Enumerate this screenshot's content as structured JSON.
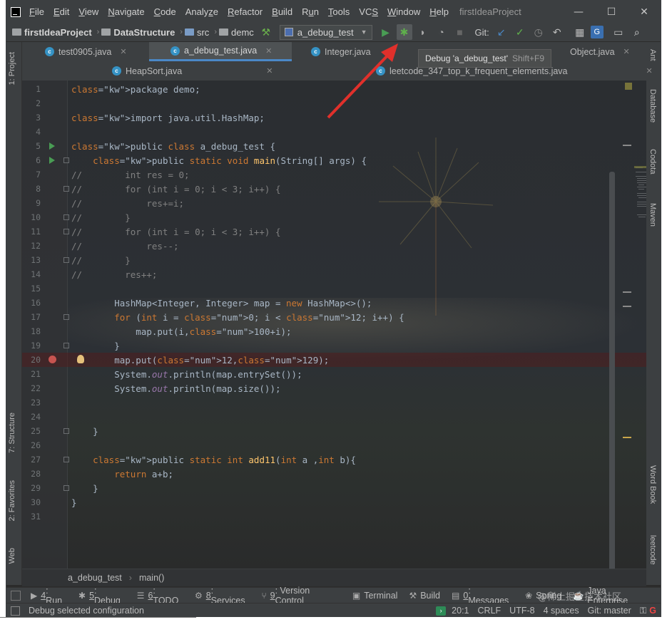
{
  "window": {
    "title": "firstIdeaProject",
    "controls": {
      "minimize": "—",
      "maximize": "☐",
      "close": "✕"
    }
  },
  "menu": [
    {
      "label": "File",
      "key": "F"
    },
    {
      "label": "Edit",
      "key": "E"
    },
    {
      "label": "View",
      "key": "V"
    },
    {
      "label": "Navigate",
      "key": "N"
    },
    {
      "label": "Code",
      "key": "C"
    },
    {
      "label": "Analyze",
      "key": "z"
    },
    {
      "label": "Refactor",
      "key": "R"
    },
    {
      "label": "Build",
      "key": "B"
    },
    {
      "label": "Run",
      "key": "u"
    },
    {
      "label": "Tools",
      "key": "T"
    },
    {
      "label": "VCS",
      "key": "S"
    },
    {
      "label": "Window",
      "key": "W"
    },
    {
      "label": "Help",
      "key": "H"
    }
  ],
  "navbar": {
    "project": "firstIdeaProject",
    "module": "DataStructure",
    "src": "src",
    "package": "demc",
    "run_config": "a_debug_test",
    "git_label": "Git:"
  },
  "tooltip": {
    "text": "Debug 'a_debug_test'",
    "shortcut": "Shift+F9"
  },
  "tabs": {
    "row1": [
      {
        "label": "test0905.java",
        "active": false
      },
      {
        "label": "a_debug_test.java",
        "active": true
      },
      {
        "label": "Integer.java",
        "active": false
      },
      {
        "label": "Object.java",
        "active": false
      }
    ],
    "row2": [
      {
        "label": "HeapSort.java"
      },
      {
        "label": "leetcode_347_top_k_frequent_elements.java"
      }
    ]
  },
  "left_tools": {
    "project": "1: Project",
    "structure": "7: Structure",
    "favorites": "2: Favorites",
    "web": "Web"
  },
  "right_tools": {
    "ant": "Ant",
    "database": "Database",
    "codota": "Codota",
    "maven": "Maven",
    "wordbook": "Word Book",
    "leetcode": "leetcode"
  },
  "code": {
    "lines": [
      "package demo;",
      "",
      "import java.util.HashMap;",
      "",
      "public class a_debug_test {",
      "    public static void main(String[] args) {",
      "//        int res = 0;",
      "//        for (int i = 0; i < 3; i++) {",
      "//            res+=i;",
      "//        }",
      "//        for (int i = 0; i < 3; i++) {",
      "//            res--;",
      "//        }",
      "//        res++;",
      "",
      "        HashMap<Integer, Integer> map = new HashMap<>();",
      "        for (int i = 0; i < 12; i++) {",
      "            map.put(i,100+i);",
      "        }",
      "        map.put(12,129);",
      "        System.out.println(map.entrySet());",
      "        System.out.println(map.size());",
      "",
      "",
      "    }",
      "",
      "    public static int add11(int a ,int b){",
      "        return a+b;",
      "    }",
      "}",
      ""
    ],
    "breakpoint_line": 20
  },
  "crumbbar": {
    "class": "a_debug_test",
    "method": "main()"
  },
  "toolwindows": [
    {
      "num": "4",
      "label": ": Run",
      "icon": "▶"
    },
    {
      "num": "5",
      "label": ": Debug",
      "icon": "✱"
    },
    {
      "num": "6",
      "label": ": TODO",
      "icon": "☰"
    },
    {
      "num": "8",
      "label": ": Services",
      "icon": "⚙"
    },
    {
      "num": "9",
      "label": ": Version Control",
      "icon": "⑂"
    },
    {
      "num": "",
      "label": "Terminal",
      "icon": "▣"
    },
    {
      "num": "",
      "label": "Build",
      "icon": "⚒"
    },
    {
      "num": "0",
      "label": ": Messages",
      "icon": "▤"
    },
    {
      "num": "",
      "label": "Spring",
      "icon": "❀"
    },
    {
      "num": "",
      "label": "Java Enterprise",
      "icon": "☕"
    }
  ],
  "status": {
    "message": "Debug selected configuration",
    "position": "20:1",
    "line_sep": "CRLF",
    "encoding": "UTF-8",
    "indent": "4 spaces",
    "git": "Git: master"
  },
  "watermark": "@稀土掘金技术社区",
  "colors": {
    "keyword": "#cc7832",
    "comment": "#808080",
    "number": "#6897bb",
    "method": "#ffc66d",
    "static": "#9876aa",
    "breakpoint": "#c75450",
    "run": "#499c54",
    "arrow": "#e0302b"
  }
}
